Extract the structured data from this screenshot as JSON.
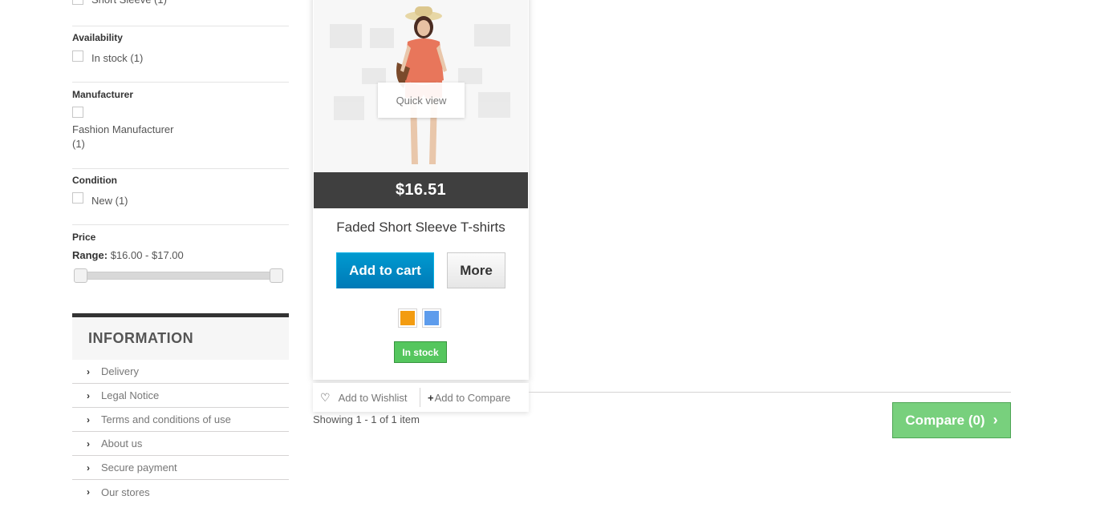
{
  "filters": {
    "style_partial": {
      "label": "Short Sleeve (1)"
    },
    "availability": {
      "title": "Availability",
      "option": "In stock (1)"
    },
    "manufacturer": {
      "title": "Manufacturer",
      "option_line1": "Fashion Manufacturer",
      "option_line2": "(1)"
    },
    "condition": {
      "title": "Condition",
      "option": "New (1)"
    },
    "price": {
      "title": "Price",
      "range_label": "Range:",
      "range_value": "$16.00 - $17.00"
    }
  },
  "information": {
    "title": "INFORMATION",
    "items": [
      {
        "label": "Delivery"
      },
      {
        "label": "Legal Notice"
      },
      {
        "label": "Terms and conditions of use"
      },
      {
        "label": "About us"
      },
      {
        "label": "Secure payment"
      },
      {
        "label": "Our stores"
      }
    ]
  },
  "product": {
    "quick_view": "Quick view",
    "price": "$16.51",
    "name": "Faded Short Sleeve T-shirts",
    "add_to_cart": "Add to cart",
    "more": "More",
    "colors": [
      "#f39c11",
      "#5d9cec"
    ],
    "stock": "In stock",
    "add_to_wishlist": "Add to Wishlist",
    "add_to_compare": "Add to Compare"
  },
  "listing": {
    "showing": "Showing 1 - 1 of 1 item",
    "compare_button": "Compare (0)"
  }
}
